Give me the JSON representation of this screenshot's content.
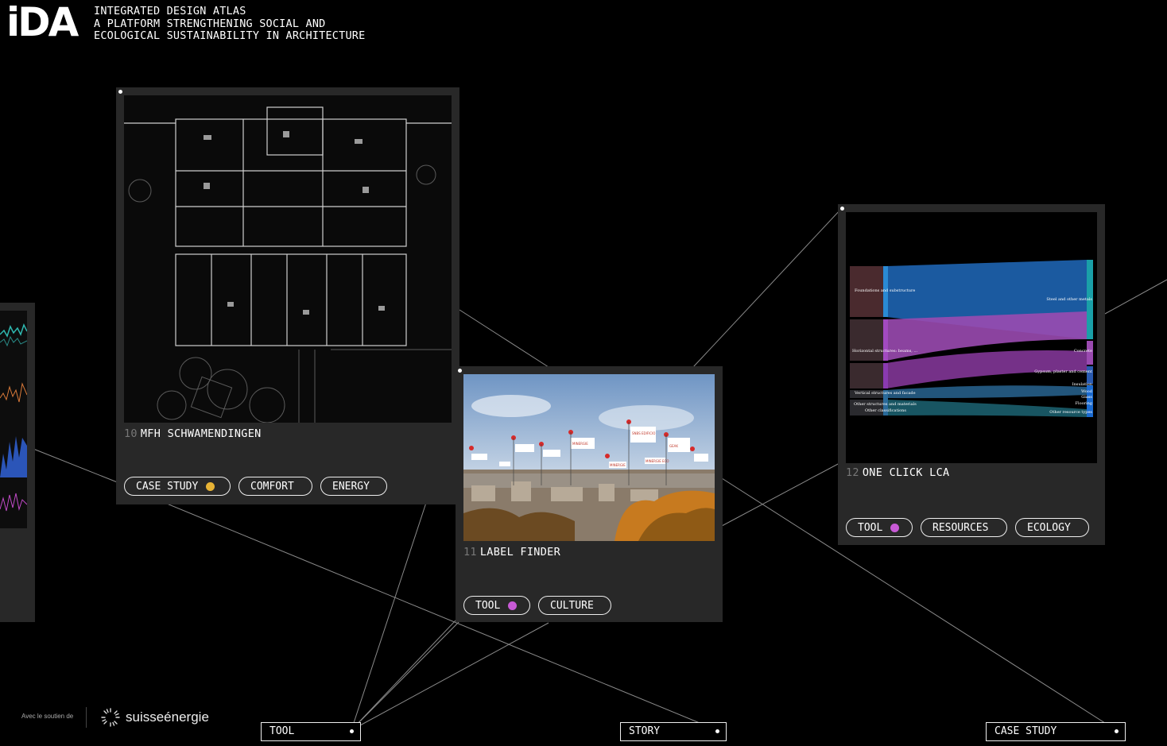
{
  "brand": {
    "logo": "iDA",
    "tagline_lines": [
      "INTEGRATED DESIGN ATLAS",
      "A PLATFORM STRENGTHENING SOCIAL AND",
      "ECOLOGICAL SUSTAINABILITY IN ARCHITECTURE"
    ]
  },
  "cards": [
    {
      "number": "10",
      "title": "MFH SCHWAMENDINGEN",
      "tags": [
        {
          "label": "CASE STUDY",
          "dot_color": "#e8b335"
        },
        {
          "label": "COMFORT"
        },
        {
          "label": "ENERGY"
        }
      ]
    },
    {
      "number": "11",
      "title": "LABEL FINDER",
      "tags": [
        {
          "label": "TOOL",
          "dot_color": "#c85ad6"
        },
        {
          "label": "CULTURE"
        }
      ],
      "flags": [
        "MINERGIE",
        "SNBS EDIFICIO",
        "MINERGIE",
        "MINERGIE ECO",
        "GEAK"
      ]
    },
    {
      "number": "12",
      "title": "ONE CLICK LCA",
      "tags": [
        {
          "label": "TOOL",
          "dot_color": "#c85ad6"
        },
        {
          "label": "RESOURCES"
        },
        {
          "label": "ECOLOGY"
        }
      ],
      "sankey_labels_left": [
        "Foundations and substructure",
        "Horizontal structures: beams, ...",
        "Vertical structures and facade",
        "Other structures and materials",
        "Other classifications"
      ],
      "sankey_labels_right": [
        "Steel and other metals",
        "Concrete",
        "Gypsum, plaster and cement",
        "Insulation",
        "Wood",
        "Glass",
        "Flooring",
        "Other resource types"
      ]
    }
  ],
  "nav": {
    "tool": "TOOL",
    "story": "STORY",
    "case_study": "CASE STUDY"
  },
  "footer": {
    "support_text": "Avec le soutien de",
    "sponsor": "suisseénergie"
  }
}
